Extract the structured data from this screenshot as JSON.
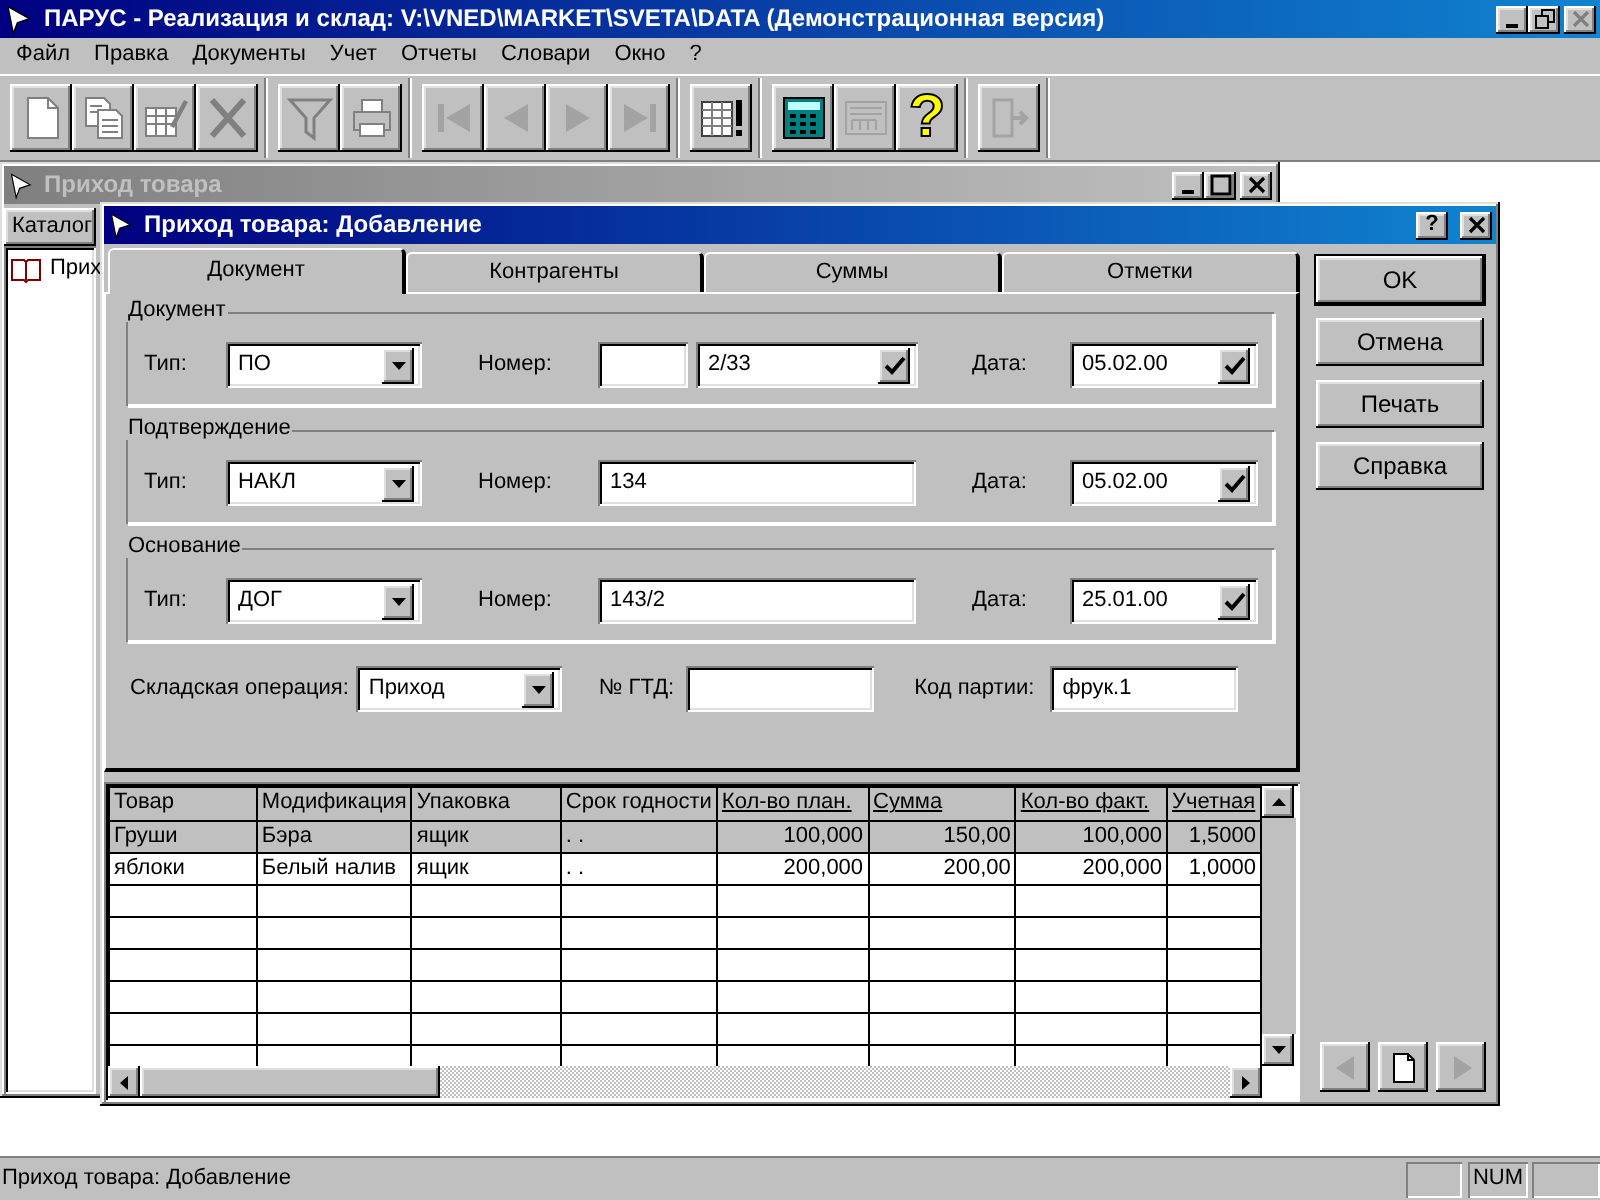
{
  "app_window": {
    "title": "ПАРУС - Реализация и склад: V:\\VNED\\MARKET\\SVETA\\DATA (Демонстрационная версия)"
  },
  "menu": [
    "Файл",
    "Правка",
    "Документы",
    "Учет",
    "Отчеты",
    "Словари",
    "Окно",
    "?"
  ],
  "toolbar": [
    [
      {
        "kind": "new",
        "disabled": false
      },
      {
        "kind": "copy",
        "disabled": false
      },
      {
        "kind": "edit",
        "disabled": false
      },
      {
        "kind": "delete",
        "disabled": false
      }
    ],
    [
      {
        "kind": "filter",
        "disabled": false
      },
      {
        "kind": "print",
        "disabled": false
      }
    ],
    [
      {
        "kind": "first",
        "disabled": true
      },
      {
        "kind": "prev",
        "disabled": true
      },
      {
        "kind": "next",
        "disabled": true
      },
      {
        "kind": "last",
        "disabled": true
      }
    ],
    [
      {
        "kind": "table-alert",
        "disabled": false
      }
    ],
    [
      {
        "kind": "calculator",
        "disabled": false
      },
      {
        "kind": "logo",
        "disabled": true
      },
      {
        "kind": "help",
        "label": "?",
        "disabled": false
      }
    ],
    [
      {
        "kind": "exit",
        "disabled": true
      }
    ]
  ],
  "back_window": {
    "title": "Приход товара",
    "tab": "Каталог",
    "tree_item": "Прих"
  },
  "dialog": {
    "title": "Приход товара: Добавление",
    "help_button": "?",
    "tabs": [
      {
        "label": "Документ",
        "selected": true
      },
      {
        "label": "Контрагенты",
        "selected": false
      },
      {
        "label": "Суммы",
        "selected": false
      },
      {
        "label": "Отметки",
        "selected": false
      }
    ],
    "groups": [
      {
        "title": "Документ",
        "type_label": "Тип:",
        "type_value": "ПО",
        "number_label": "Номер:",
        "number_fields": [
          {
            "kind": "input"
          },
          {
            "kind": "combo",
            "value": "2/33"
          }
        ],
        "date_label": "Дата:",
        "date_value": "05.02.00"
      },
      {
        "title": "Подтверждение",
        "type_label": "Тип:",
        "type_value": "НАКЛ",
        "number_label": "Номер:",
        "number_fields": [
          {
            "kind": "input",
            "value": "134"
          }
        ],
        "date_label": "Дата:",
        "date_value": "05.02.00"
      },
      {
        "title": "Основание",
        "type_label": "Тип:",
        "type_value": "ДОГ",
        "number_label": "Номер:",
        "number_fields": [
          {
            "kind": "input",
            "value": "143/2"
          }
        ],
        "date_label": "Дата:",
        "date_value": "25.01.00"
      }
    ],
    "operation": {
      "label": "Складская операция:",
      "value": "Приход"
    },
    "gtd": {
      "label": "№ ГТД:"
    },
    "batch": {
      "label": "Код партии:",
      "value": "фрук.1"
    },
    "buttons": [
      {
        "label": "OK",
        "default": true
      },
      {
        "label": "Отмена",
        "default": false
      },
      {
        "label": "Печать",
        "default": false
      },
      {
        "label": "Справка",
        "default": false
      }
    ],
    "grid": {
      "columns": [
        {
          "label": "Товар",
          "kind": "text",
          "underlined": false
        },
        {
          "label": "Модификация",
          "kind": "text",
          "underlined": false
        },
        {
          "label": "Упаковка",
          "kind": "text",
          "underlined": false
        },
        {
          "label": "Срок годности",
          "kind": "text",
          "underlined": false
        },
        {
          "label": "Кол-во план.",
          "kind": "number",
          "underlined": true
        },
        {
          "label": "Сумма",
          "kind": "number",
          "underlined": true
        },
        {
          "label": "Кол-во факт.",
          "kind": "number",
          "underlined": true
        },
        {
          "label": "Учетная",
          "kind": "number",
          "underlined": true
        }
      ],
      "rows": [
        {
          "selected": true,
          "cells": [
            "Груши",
            "Бэра",
            "ящик",
            ". .",
            "100,000",
            "150,00",
            "100,000",
            "1,5000"
          ]
        },
        {
          "selected": false,
          "cells": [
            "яблоки",
            "Белый налив",
            "ящик",
            ". .",
            "200,000",
            "200,00",
            "200,000",
            "1,0000"
          ]
        }
      ]
    },
    "nav": [
      {
        "kind": "prev",
        "disabled": true
      },
      {
        "kind": "new",
        "disabled": false
      },
      {
        "kind": "next",
        "disabled": true
      }
    ]
  },
  "status_bar": {
    "text": "Приход товара: Добавление",
    "indicator": "NUM"
  }
}
